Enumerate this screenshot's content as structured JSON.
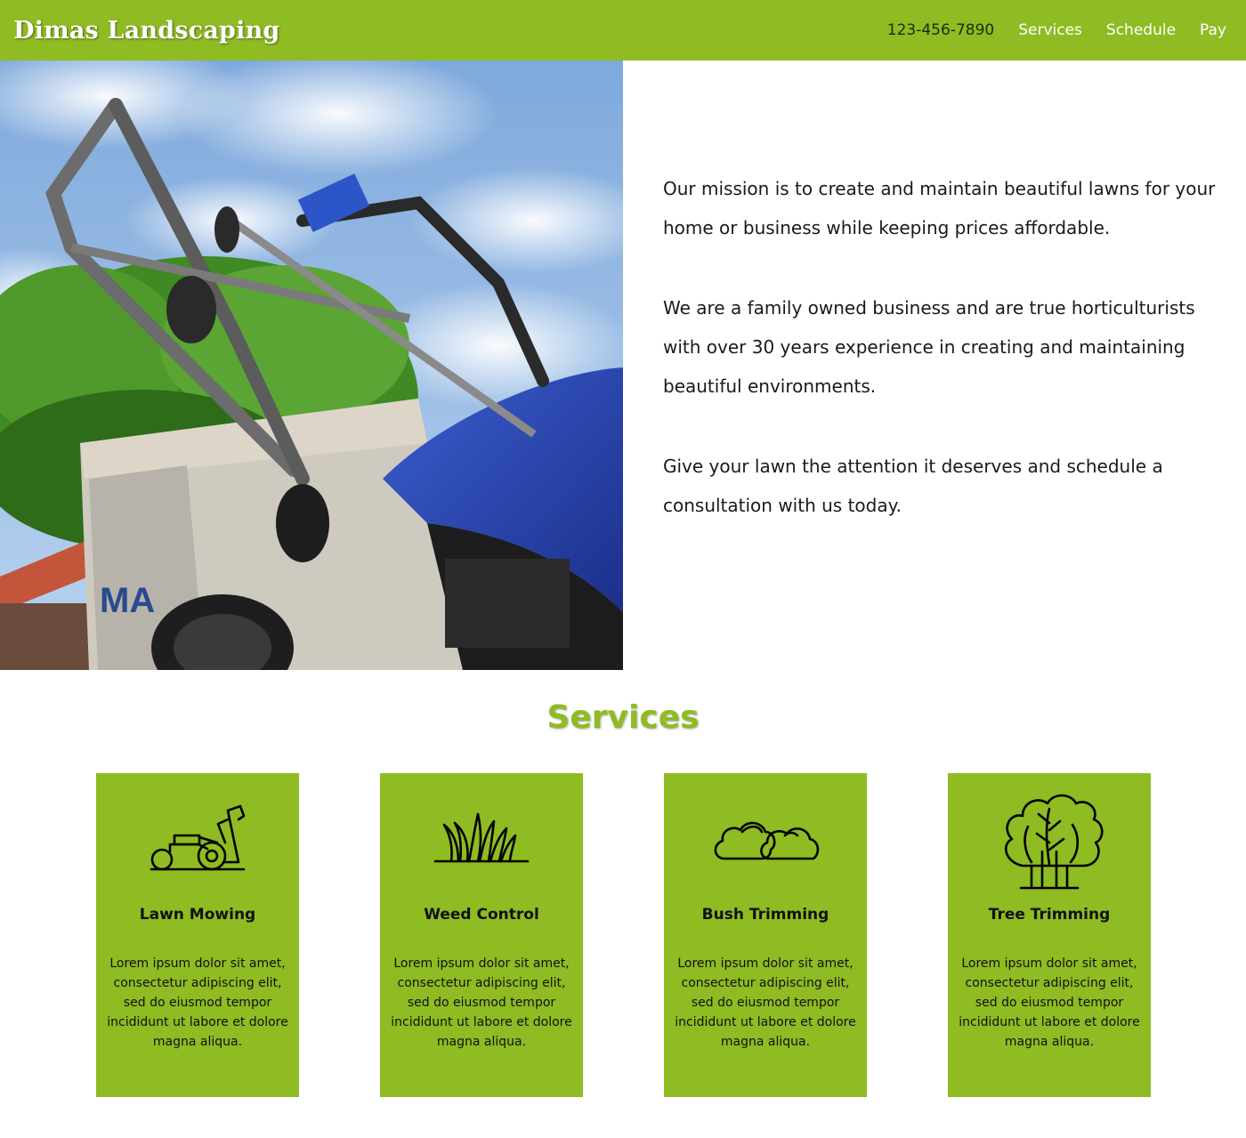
{
  "header": {
    "brand": "Dimas Landscaping",
    "nav": {
      "phone": "123-456-7890",
      "services": "Services",
      "schedule": "Schedule",
      "pay": "Pay"
    }
  },
  "colors": {
    "brand_green": "#8fbb23",
    "text": "#1a1a1a",
    "white": "#ffffff"
  },
  "hero": {
    "image": "lawn-mower-photo",
    "paragraphs": [
      "Our mission is to create and maintain beautiful lawns for your home or business while keeping prices affordable.",
      "We are a family owned business and are true horticulturists with over 30 years experience in creating and maintaining beautiful environments.",
      "Give your lawn the attention it deserves and schedule a consultation with us today."
    ]
  },
  "services": {
    "title": "Services",
    "cards": [
      {
        "icon": "lawn-mower-icon",
        "title": "Lawn Mowing",
        "text": "Lorem ipsum dolor sit amet, consectetur adipiscing elit, sed do eiusmod tempor incididunt ut labore et dolore magna aliqua."
      },
      {
        "icon": "grass-icon",
        "title": "Weed Control",
        "text": "Lorem ipsum dolor sit amet, consectetur adipiscing elit, sed do eiusmod tempor incididunt ut labore et dolore magna aliqua."
      },
      {
        "icon": "bush-icon",
        "title": "Bush Trimming",
        "text": "Lorem ipsum dolor sit amet, consectetur adipiscing elit, sed do eiusmod tempor incididunt ut labore et dolore magna aliqua."
      },
      {
        "icon": "tree-icon",
        "title": "Tree Trimming",
        "text": "Lorem ipsum dolor sit amet, consectetur adipiscing elit, sed do eiusmod tempor incididunt ut labore et dolore magna aliqua."
      }
    ]
  }
}
